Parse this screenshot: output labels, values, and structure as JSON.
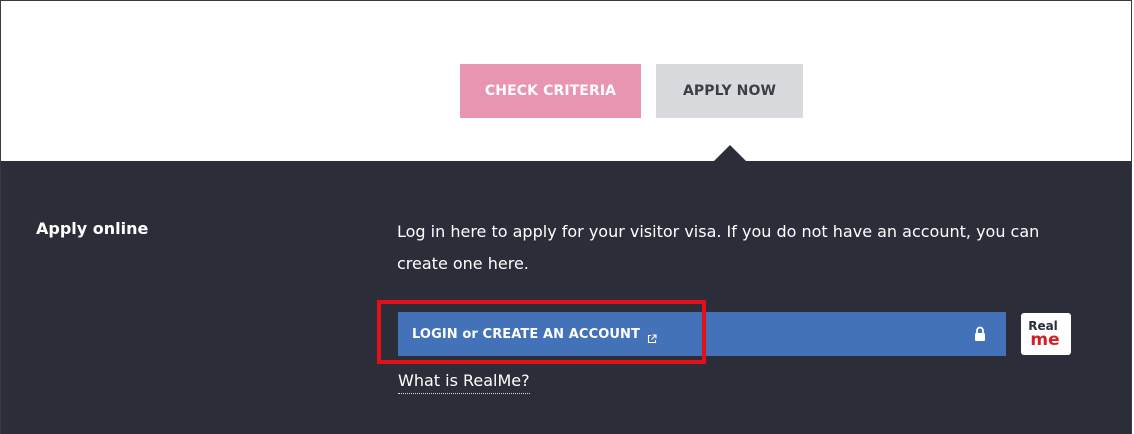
{
  "tabs": {
    "check_criteria": "CHECK CRITERIA",
    "apply_now": "APPLY NOW"
  },
  "apply_online": {
    "label": "Apply online",
    "intro_line1": "Log in here to apply for your visitor visa. If you do not have an account, you can",
    "intro_line2": "create one here.",
    "login_button": "LOGIN or CREATE AN ACCOUNT",
    "realme_logo_top": "Real",
    "realme_logo_bottom": "me",
    "what_is_link": "What is RealMe?"
  },
  "colors": {
    "criteria_tab": "#e895b1",
    "apply_tab": "#d9dadd",
    "panel": "#2b2e38",
    "login_bar": "#4472b8",
    "highlight": "#e3101a",
    "realme_red": "#d51f27"
  },
  "icons": {
    "external_link": "external-link-icon",
    "lock": "lock-icon"
  }
}
